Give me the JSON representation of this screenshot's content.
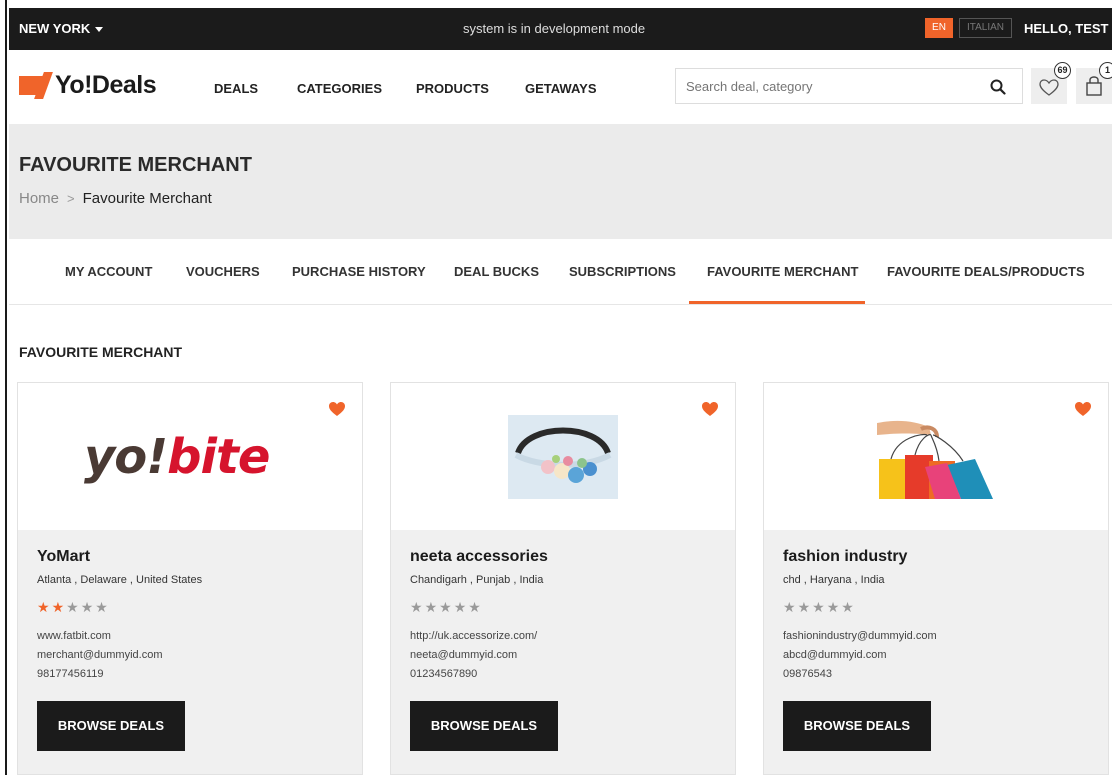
{
  "topbar": {
    "city": "NEW YORK",
    "dev_mode": "system is in development mode",
    "lang_en": "EN",
    "lang_it": "ITALIAN",
    "greeting": "HELLO, TEST"
  },
  "header": {
    "logo_text": "Yo!Deals",
    "nav": [
      "DEALS",
      "CATEGORIES",
      "PRODUCTS",
      "GETAWAYS"
    ],
    "search_placeholder": "Search deal, category",
    "wishlist_count": "69",
    "cart_count": "1"
  },
  "page": {
    "title": "FAVOURITE MERCHANT",
    "breadcrumb_home": "Home",
    "breadcrumb_current": "Favourite Merchant"
  },
  "tabs": [
    "MY ACCOUNT",
    "VOUCHERS",
    "PURCHASE HISTORY",
    "DEAL BUCKS",
    "SUBSCRIPTIONS",
    "FAVOURITE MERCHANT",
    "FAVOURITE DEALS/PRODUCTS"
  ],
  "active_tab": "FAVOURITE MERCHANT",
  "section_title": "FAVOURITE MERCHANT",
  "colors": {
    "accent": "#f0642a",
    "dark": "#1b1b1b",
    "panel": "#f0f0f0"
  },
  "merchants": [
    {
      "name": "YoMart",
      "location": "Atlanta , Delaware , United States",
      "rating": 2,
      "website": "www.fatbit.com",
      "email": "merchant@dummyid.com",
      "phone": "98177456119",
      "logo_text_a": "yo!",
      "logo_text_b": "bite",
      "button": "BROWSE DEALS"
    },
    {
      "name": "neeta accessories",
      "location": "Chandigarh , Punjab , India",
      "rating": 0,
      "website": "http://uk.accessorize.com/",
      "email": "neeta@dummyid.com",
      "phone": "01234567890",
      "button": "BROWSE DEALS"
    },
    {
      "name": "fashion industry",
      "location": "chd , Haryana , India",
      "rating": 0,
      "website": "fashionindustry@dummyid.com",
      "email": "abcd@dummyid.com",
      "phone": "09876543",
      "button": "BROWSE DEALS"
    }
  ]
}
